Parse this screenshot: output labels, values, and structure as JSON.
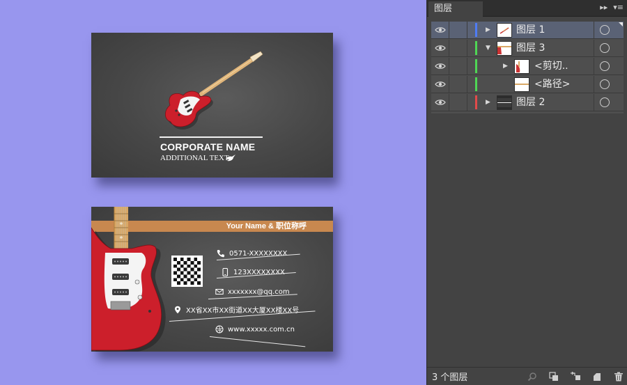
{
  "card_front": {
    "corporate_name": "CORPORATE NAME",
    "additional_text": "ADDITIONAL TEXT"
  },
  "card_back": {
    "name_title": "Your Name & 职位称呼",
    "phone": "0571-XXXXXXXX",
    "mobile": "123XXXXXXXX",
    "email": "xxxxxxx@qq.com",
    "address": "XX省XX市XX街道XX大厦XX楼XX号",
    "website": "www.xxxxx.com.cn"
  },
  "layers_panel": {
    "tab_title": "图层",
    "layers": [
      {
        "name": "图层 1",
        "color": "#4f7cf5",
        "expanded": false,
        "selected": true
      },
      {
        "name": "图层 3",
        "color": "#4fd655",
        "expanded": true,
        "selected": false
      },
      {
        "name": "<剪切..",
        "color": "#4fd655",
        "expanded": false,
        "selected": false
      },
      {
        "name": "<路径>",
        "color": "#4fd655",
        "expanded": false,
        "selected": false
      },
      {
        "name": "图层 2",
        "color": "#e24a4a",
        "expanded": false,
        "selected": false
      }
    ],
    "layer_count": "3 个图层"
  },
  "colors": {
    "background": "#9896ee",
    "card": "#474747",
    "accent_band": "#c8884f",
    "guitar_body": "#cc1f2b"
  },
  "icons": [
    "eye-icon",
    "expand-arrow-icon",
    "target-circle-icon",
    "phone-icon",
    "mobile-icon",
    "mail-icon",
    "location-icon",
    "globe-icon",
    "search-icon",
    "clip-mask-icon",
    "new-sublayer-icon",
    "new-layer-icon",
    "trash-icon",
    "panel-menu-icon",
    "collapse-icon"
  ]
}
